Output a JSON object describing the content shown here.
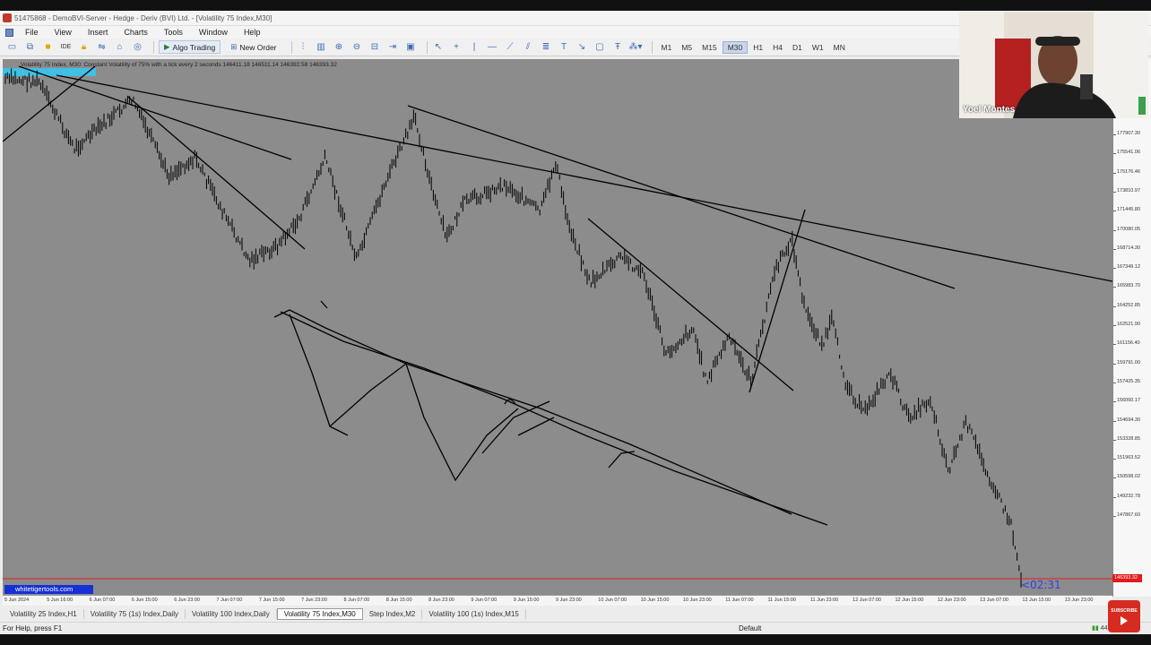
{
  "titlebar": {
    "title": "51475868 - DemoBVI-Server - Hedge - Deriv (BVI) Ltd. - [Volatility 75 Index,M30]"
  },
  "menu": [
    "File",
    "View",
    "Insert",
    "Charts",
    "Tools",
    "Window",
    "Help"
  ],
  "toolbar": {
    "algo_trading": "Algo Trading",
    "new_order": "New Order",
    "timeframes": [
      "M1",
      "M5",
      "M15",
      "M30",
      "H1",
      "H4",
      "D1",
      "W1",
      "MN"
    ],
    "active_timeframe": "M30",
    "icons": [
      "new-chart-icon",
      "profiles-icon",
      "market-watch-icon",
      "ide-icon",
      "navigator-icon",
      "data-window-icon",
      "strategy-tester-icon",
      "terminal-icon"
    ]
  },
  "chart": {
    "header": "Volatility 75 Index, M30: Constant Volatility of 75% with a tick every 2 seconds  146411.18 146511.14 146392.58 146393.32",
    "price_labels": [
      "177907.30",
      "175541.06",
      "175176.46",
      "173810.97",
      "171445.80",
      "170080.05",
      "168714.30",
      "167349.12",
      "165983.70",
      "164252.85",
      "162521.90",
      "161156.40",
      "159791.00",
      "157425.35",
      "156060.17",
      "154694.30",
      "153328.85",
      "151963.52",
      "150598.02",
      "149232.78",
      "147867.60",
      "146393.32"
    ],
    "time_labels": [
      "5 Jun 2024",
      "5 Jun 16:00",
      "6 Jun 07:00",
      "6 Jun 15:00",
      "6 Jun 23:00",
      "7 Jun 07:00",
      "7 Jun 15:00",
      "7 Jun 23:00",
      "8 Jun 07:00",
      "8 Jun 15:00",
      "8 Jun 23:00",
      "9 Jun 07:00",
      "9 Jun 15:00",
      "9 Jun 23:00",
      "10 Jun 07:00",
      "10 Jun 15:00",
      "10 Jun 23:00",
      "11 Jun 07:00",
      "11 Jun 15:00",
      "11 Jun 23:00",
      "12 Jun 07:00",
      "12 Jun 15:00",
      "12 Jun 23:00",
      "13 Jun 07:00",
      "13 Jun 15:00",
      "13 Jun 23:00"
    ],
    "countdown": "<02:31",
    "watermark": "whitetigertools.com",
    "colors": {
      "background": "#8c8c8c",
      "candle": "#000000",
      "bid_line": "#e21b1b"
    }
  },
  "tabs": [
    "Volatility 25 Index,H1",
    "Volatility 75 (1s) Index,Daily",
    "Volatility 100 Index,Daily",
    "Volatility 75 Index,M30",
    "Step Index,M2",
    "Volatility 100 (1s) Index,M15"
  ],
  "active_tab": "Volatility 75 Index,M30",
  "status": {
    "help": "For Help, press F1",
    "profile": "Default",
    "traffic": "44.3"
  },
  "webcam": {
    "name": "Yoel Montes"
  },
  "subscribe": {
    "label": "SUBSCRIBE"
  }
}
